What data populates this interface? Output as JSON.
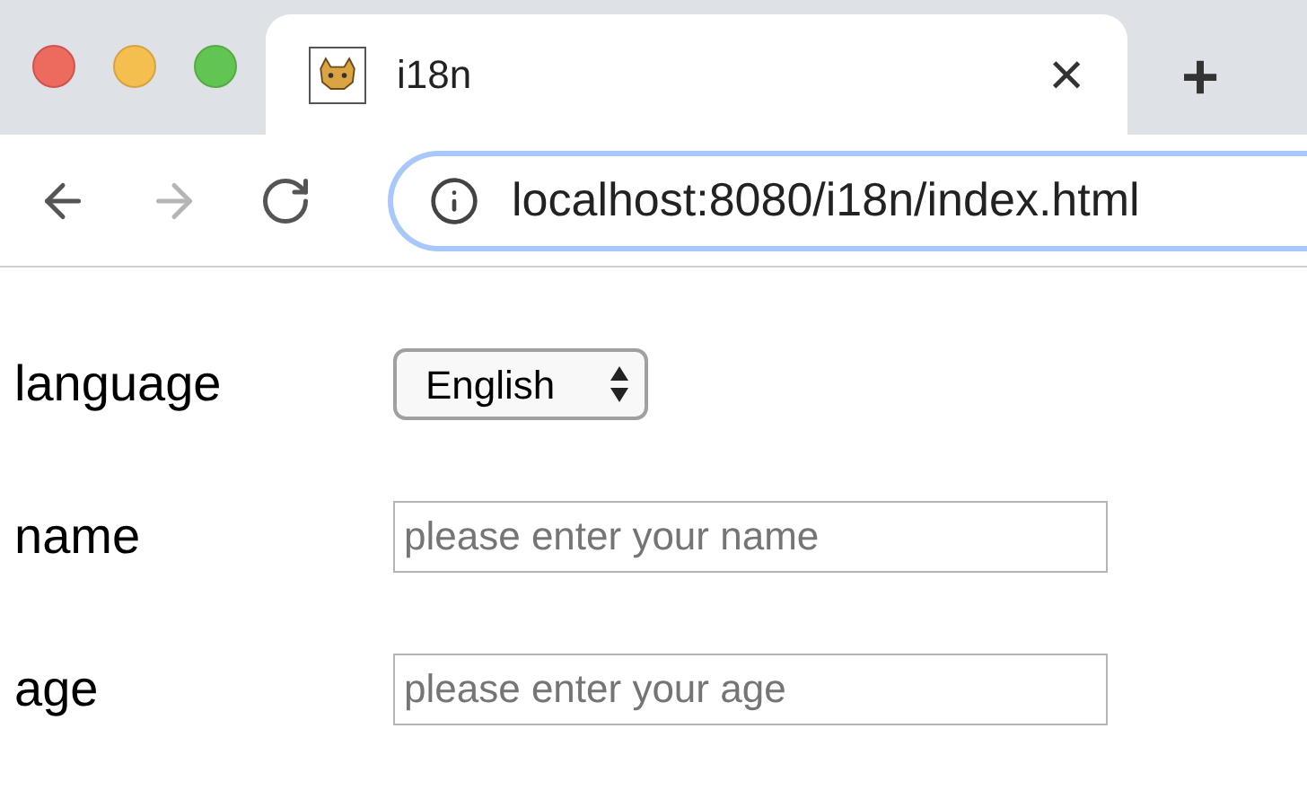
{
  "browser": {
    "tab": {
      "title": "i18n",
      "close": "×",
      "selected": true
    },
    "new_tab": "+",
    "nav": [
      {
        "kind": "back",
        "disabled": false
      },
      {
        "kind": "forward",
        "disabled": true
      },
      {
        "kind": "reload",
        "disabled": false
      }
    ],
    "address": "localhost:8080/i18n/index.html"
  },
  "form": [
    {
      "kind": "select",
      "label": "language",
      "value": "English"
    },
    {
      "kind": "text",
      "label": "name",
      "placeholder": "please enter your name"
    },
    {
      "kind": "text",
      "label": "age",
      "placeholder": "please enter your age"
    }
  ]
}
